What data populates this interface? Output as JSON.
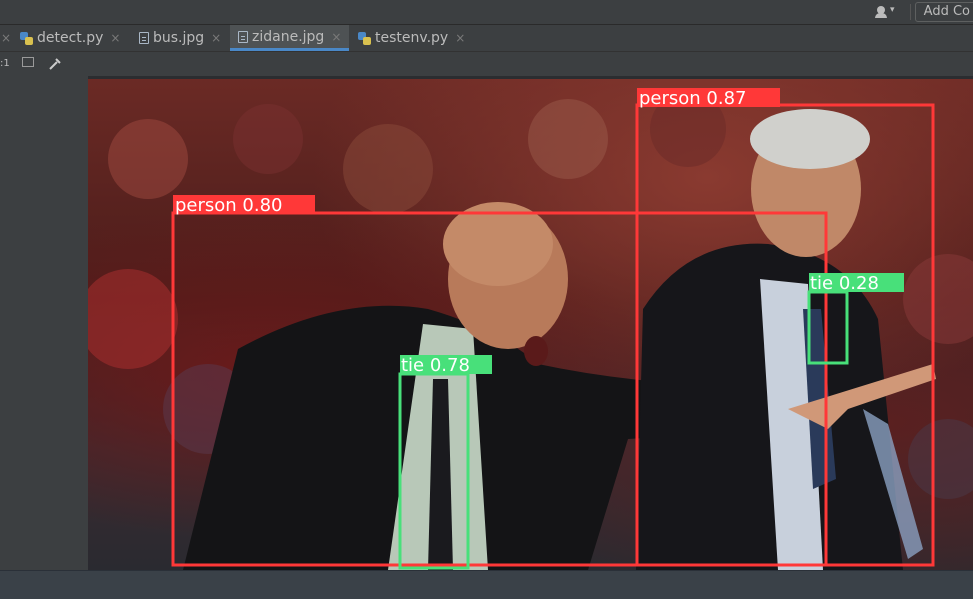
{
  "toolbar_right": {
    "add_config_label": "Add Co"
  },
  "tabs": [
    {
      "name": "detect.py",
      "icon": "python-file-icon",
      "active": false
    },
    {
      "name": "bus.jpg",
      "icon": "image-file-icon",
      "active": false
    },
    {
      "name": "zidane.jpg",
      "icon": "image-file-icon",
      "active": true
    },
    {
      "name": "testenv.py",
      "icon": "python-file-icon",
      "active": false
    }
  ],
  "image_toolbar": {
    "icons": [
      "grid-icon",
      "frame-icon",
      "color-picker-icon"
    ]
  },
  "detections": [
    {
      "label": "person 0.87",
      "color": "#ff3838"
    },
    {
      "label": "person 0.80",
      "color": "#ff3838"
    },
    {
      "label": "tie 0.78",
      "color": "#48e07a"
    },
    {
      "label": "tie 0.28",
      "color": "#48e07a"
    }
  ],
  "colors": {
    "person_box": "#ff3838",
    "tie_box": "#48e07a",
    "tab_accent": "#4a88c7"
  }
}
